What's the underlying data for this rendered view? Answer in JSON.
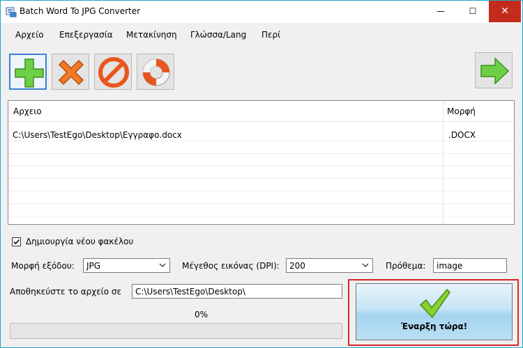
{
  "window": {
    "title": "Batch Word To JPG Converter",
    "controls": {
      "minimize": "—",
      "maximize": "☐",
      "close": "✕"
    }
  },
  "menu": {
    "items": [
      "Αρχείο",
      "Επεξεργασία",
      "Μετακίνηση",
      "Γλώσσα/Lang",
      "Περί"
    ]
  },
  "toolbar": {
    "buttons": [
      {
        "icon": "plus-icon",
        "color": "#5cc43a"
      },
      {
        "icon": "x-icon",
        "color": "#f06a1e"
      },
      {
        "icon": "no-entry-icon",
        "color": "#e8541c"
      },
      {
        "icon": "lifebuoy-icon",
        "color": "#e8541c"
      },
      {
        "icon": "arrow-right-icon",
        "color": "#5cc43a"
      }
    ]
  },
  "file_list": {
    "columns": [
      "Αρχειο",
      "Μορφή"
    ],
    "rows": [
      {
        "path": "C:\\Users\\TestEgo\\Desktop\\Εγγραφο.docx",
        "format": ".DOCX"
      }
    ]
  },
  "options": {
    "create_folder_label": "Δημιουργία νέου φακέλου",
    "create_folder_checked": true,
    "output_format_label": "Μορφή εξόδου:",
    "output_format_value": "JPG",
    "dpi_label": "Μέγεθος εικόνας (DPI):",
    "dpi_value": "200",
    "prefix_label": "Πρόθεμα:",
    "prefix_value": "image",
    "save_label": "Αποθηκεύστε το αρχείο σε",
    "save_path": "C:\\Users\\TestEgo\\Desktop\\"
  },
  "progress": {
    "text": "0%",
    "value": 0
  },
  "start": {
    "label": "Έναρξη τώρα!",
    "highlight_color": "#d9262b"
  }
}
